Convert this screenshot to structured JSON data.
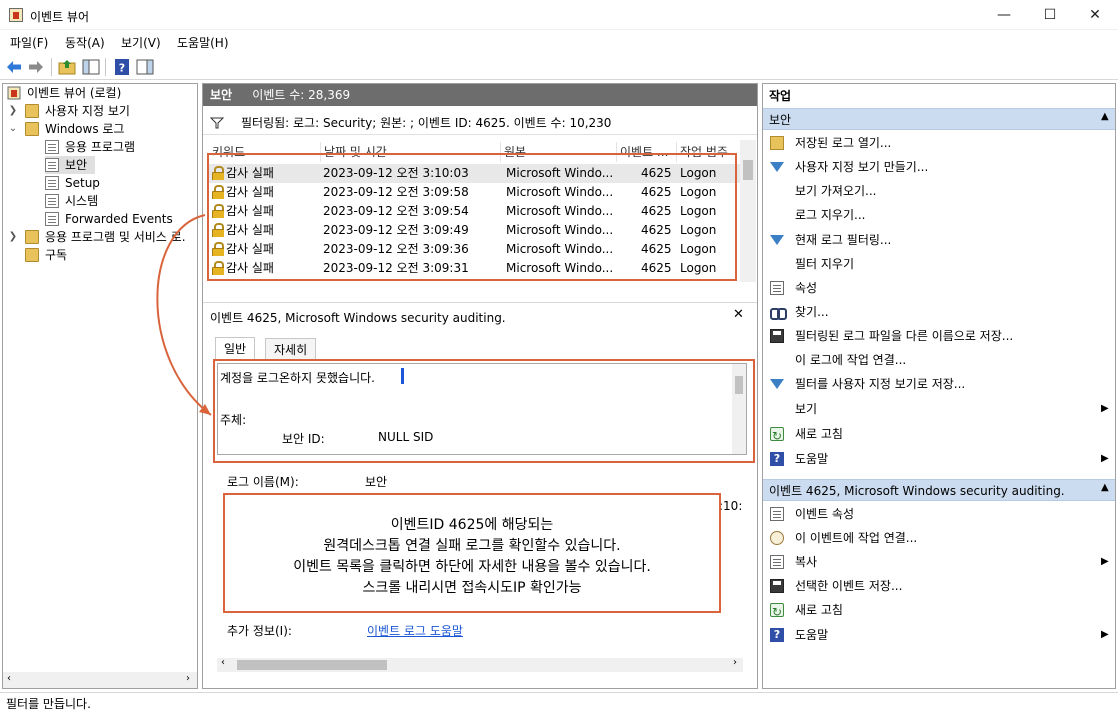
{
  "window": {
    "title": "이벤트 뷰어",
    "minimize": "—",
    "maximize": "☐",
    "close": "✕"
  },
  "menu": [
    "파일(F)",
    "동작(A)",
    "보기(V)",
    "도움말(H)"
  ],
  "tree": {
    "root": "이벤트 뷰어 (로컬)",
    "custom_views": "사용자 지정 보기",
    "windows_logs": "Windows 로그",
    "logs": [
      "응용 프로그램",
      "보안",
      "Setup",
      "시스템",
      "Forwarded Events"
    ],
    "app_services": "응용 프로그램 및 서비스 로.",
    "subscriptions": "구독"
  },
  "log_header": {
    "name": "보안",
    "count_label": "이벤트 수: 28,369"
  },
  "filter_text": "필터링됨: 로그: Security; 원본: ; 이벤트 ID: 4625. 이벤트 수: 10,230",
  "columns": [
    "키워드",
    "날짜 및 시간",
    "원본",
    "이벤트 ...",
    "작업 범주"
  ],
  "events": [
    {
      "keyword": "감사 실패",
      "datetime": "2023-09-12 오전 3:10:03",
      "source": "Microsoft Windo...",
      "id": "4625",
      "category": "Logon"
    },
    {
      "keyword": "감사 실패",
      "datetime": "2023-09-12 오전 3:09:58",
      "source": "Microsoft Windo...",
      "id": "4625",
      "category": "Logon"
    },
    {
      "keyword": "감사 실패",
      "datetime": "2023-09-12 오전 3:09:54",
      "source": "Microsoft Windo...",
      "id": "4625",
      "category": "Logon"
    },
    {
      "keyword": "감사 실패",
      "datetime": "2023-09-12 오전 3:09:49",
      "source": "Microsoft Windo...",
      "id": "4625",
      "category": "Logon"
    },
    {
      "keyword": "감사 실패",
      "datetime": "2023-09-12 오전 3:09:36",
      "source": "Microsoft Windo...",
      "id": "4625",
      "category": "Logon"
    },
    {
      "keyword": "감사 실패",
      "datetime": "2023-09-12 오전 3:09:31",
      "source": "Microsoft Windo...",
      "id": "4625",
      "category": "Logon"
    }
  ],
  "detail": {
    "title": "이벤트 4625, Microsoft Windows security auditing.",
    "close": "✕",
    "tabs": [
      "일반",
      "자세히"
    ],
    "message_line1": "계정을 로그온하지 못했습니다.",
    "message_line2": "주체:",
    "security_id_label": "보안 ID:",
    "security_id_value": "NULL SID",
    "log_name_label": "로그 이름(M):",
    "log_name_value": "보안",
    "clipped_value": ":10:",
    "more_info_label": "추가 정보(I):",
    "more_info_link": "이벤트 로그 도움말"
  },
  "annotation": {
    "lines": [
      "이벤트ID 4625에 해당되는",
      "원격데스크톱 연결 실패 로그를 확인할수 있습니다.",
      "이벤트 목록을 클릭하면 하단에 자세한 내용을 볼수 있습니다.",
      "스크롤 내리시면 접속시도IP 확인가능"
    ],
    "color": "#d9643c"
  },
  "actions": {
    "title": "작업",
    "section1": "보안",
    "items1": [
      {
        "label": "저장된 로그 열기...",
        "icon": "folder-open-icon"
      },
      {
        "label": "사용자 지정 보기 만들기...",
        "icon": "filter-icon"
      },
      {
        "label": "보기 가져오기...",
        "icon": ""
      },
      {
        "label": "로그 지우기...",
        "icon": ""
      },
      {
        "label": "현재 로그 필터링...",
        "icon": "filter-icon"
      },
      {
        "label": "필터 지우기",
        "icon": ""
      },
      {
        "label": "속성",
        "icon": "properties-icon"
      },
      {
        "label": "찾기...",
        "icon": "find-icon"
      },
      {
        "label": "필터링된 로그 파일을 다른 이름으로 저장...",
        "icon": "save-icon"
      },
      {
        "label": "이 로그에 작업 연결...",
        "icon": ""
      },
      {
        "label": "필터를 사용자 지정 보기로 저장...",
        "icon": "save-filter-icon"
      },
      {
        "label": "보기",
        "icon": "",
        "submenu": true
      },
      {
        "label": "새로 고침",
        "icon": "refresh-icon"
      },
      {
        "label": "도움말",
        "icon": "help-icon",
        "submenu": true
      }
    ],
    "section2": "이벤트 4625, Microsoft Windows security auditing.",
    "items2": [
      {
        "label": "이벤트 속성",
        "icon": "properties-icon"
      },
      {
        "label": "이 이벤트에 작업 연결...",
        "icon": "task-icon"
      },
      {
        "label": "복사",
        "icon": "copy-icon",
        "submenu": true
      },
      {
        "label": "선택한 이벤트 저장...",
        "icon": "save-icon"
      },
      {
        "label": "새로 고침",
        "icon": "refresh-icon"
      },
      {
        "label": "도움말",
        "icon": "help-icon",
        "submenu": true
      }
    ]
  },
  "status": "필터를 만듭니다.",
  "accent_colors": {
    "header_gray": "#6d6d6d",
    "section_blue": "#ccdcf0",
    "annotation_orange": "#d9643c"
  }
}
